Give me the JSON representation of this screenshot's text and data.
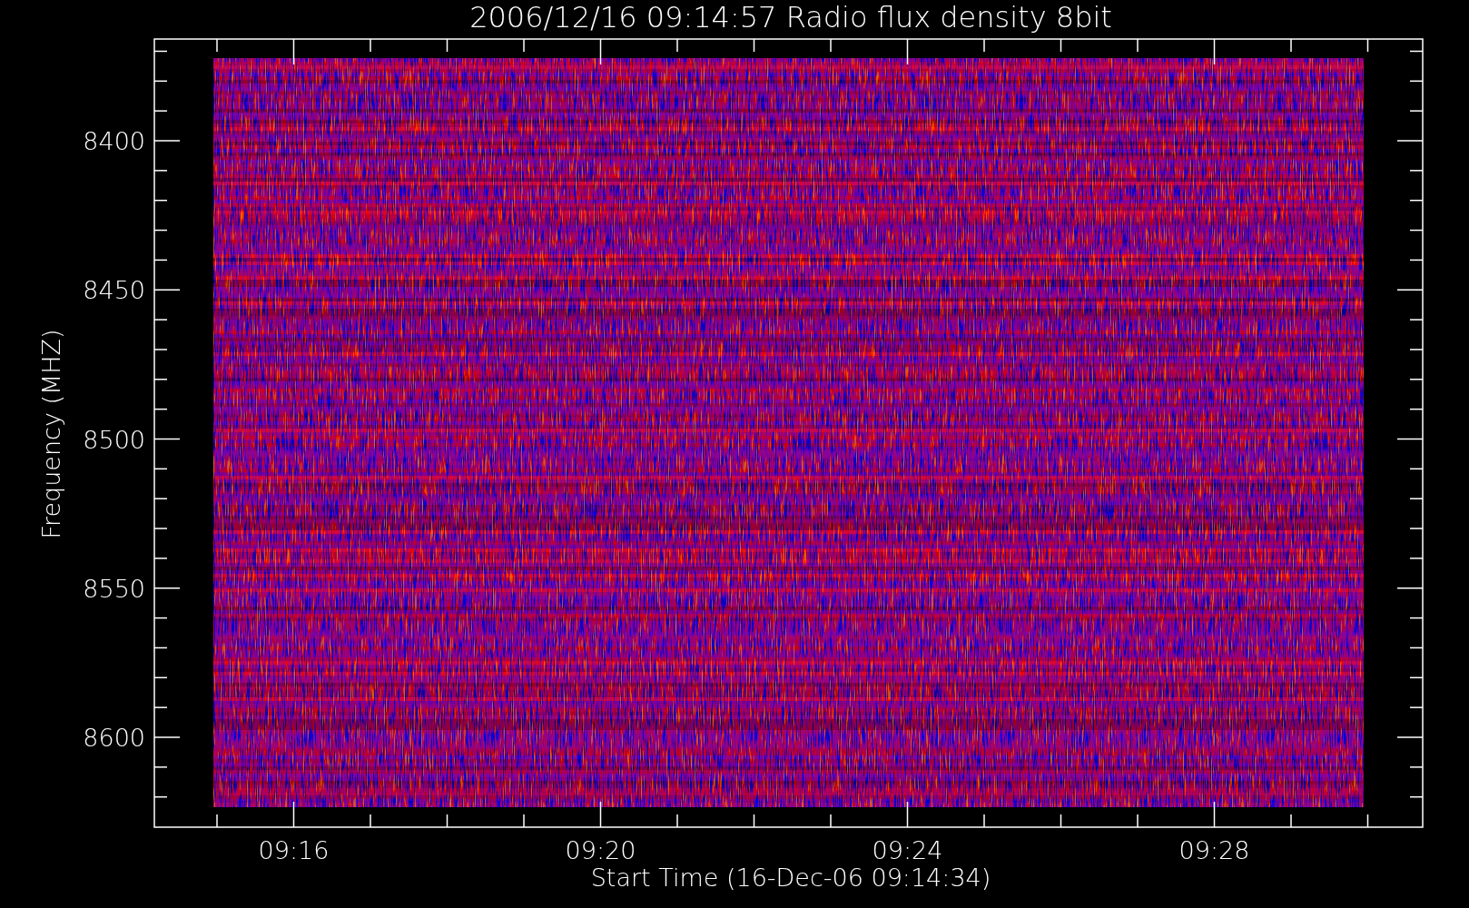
{
  "title": "2006/12/16 09:14:57 Radio flux density 8bit",
  "y_axis": {
    "label": "Frequency (MHZ)",
    "ticks": [
      "8400",
      "8450",
      "8500",
      "8550",
      "8600"
    ]
  },
  "x_axis": {
    "label": "Start Time (16-Dec-06 09:14:34)",
    "ticks": [
      "09:16",
      "09:20",
      "09:24",
      "09:28"
    ]
  }
}
